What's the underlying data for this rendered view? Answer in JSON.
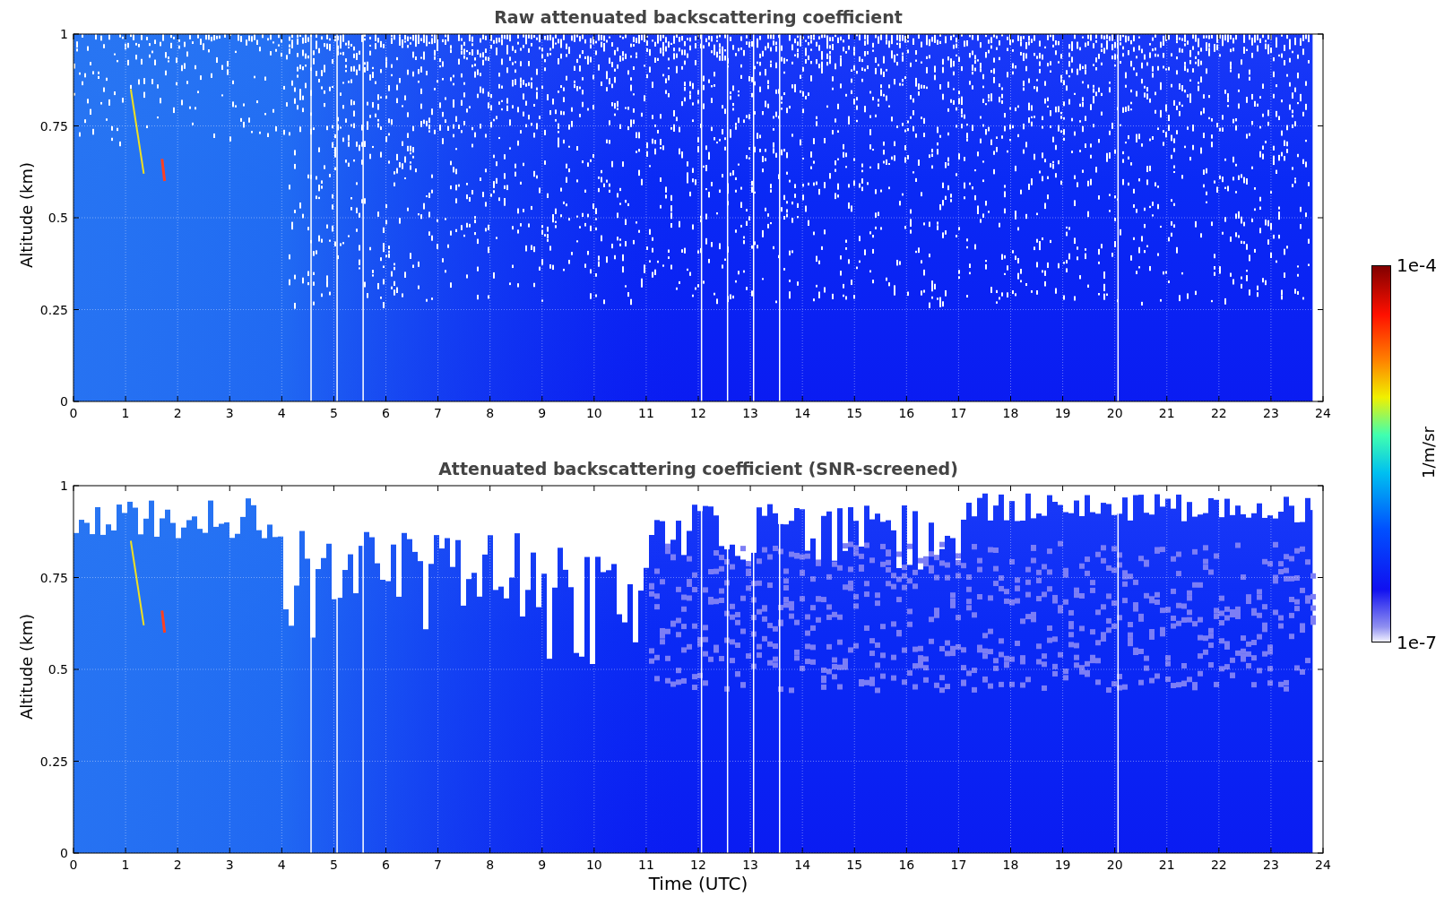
{
  "panels": [
    {
      "kind": "raw",
      "title": "Raw attenuated backscattering coefficient",
      "ylabel": "Altitude (km)",
      "yticks": [
        "1",
        "0.75",
        "0.5",
        "0.25",
        "0"
      ],
      "xticks": [
        "0",
        "1",
        "2",
        "3",
        "4",
        "5",
        "6",
        "7",
        "8",
        "9",
        "10",
        "11",
        "12",
        "13",
        "14",
        "15",
        "16",
        "17",
        "18",
        "19",
        "20",
        "21",
        "22",
        "23",
        "24"
      ]
    },
    {
      "kind": "screened",
      "title": "Attenuated backscattering coefficient (SNR-screened)",
      "ylabel": "Altitude (km)",
      "yticks": [
        "1",
        "0.75",
        "0.5",
        "0.25",
        "0"
      ],
      "xticks": [
        "0",
        "1",
        "2",
        "3",
        "4",
        "5",
        "6",
        "7",
        "8",
        "9",
        "10",
        "11",
        "12",
        "13",
        "14",
        "15",
        "16",
        "17",
        "18",
        "19",
        "20",
        "21",
        "22",
        "23",
        "24"
      ],
      "xlabel": "Time (UTC)"
    }
  ],
  "colorbar": {
    "max_label": "1e-4",
    "min_label": "1e-7",
    "label": "1/m/sr"
  }
}
